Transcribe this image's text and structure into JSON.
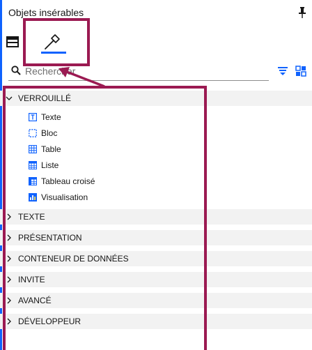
{
  "panel": {
    "title": "Objets insérables",
    "pin_icon": "pin-icon"
  },
  "tabs": [
    {
      "icon": "layout-icon",
      "selected": false
    },
    {
      "icon": "hammer-icon",
      "selected": true
    }
  ],
  "search": {
    "placeholder": "Rechercher",
    "icons": [
      "search-icon",
      "filter-icon",
      "grid-view-icon"
    ]
  },
  "tree": {
    "groups": [
      {
        "label": "VERROUILLÉ",
        "expanded": true,
        "items": [
          {
            "label": "Texte",
            "icon": "text-icon"
          },
          {
            "label": "Bloc",
            "icon": "block-icon"
          },
          {
            "label": "Table",
            "icon": "table-icon"
          },
          {
            "label": "Liste",
            "icon": "list-icon"
          },
          {
            "label": "Tableau croisé",
            "icon": "crosstab-icon"
          },
          {
            "label": "Visualisation",
            "icon": "visualization-icon"
          }
        ]
      },
      {
        "label": "TEXTE",
        "expanded": false
      },
      {
        "label": "PRÉSENTATION",
        "expanded": false
      },
      {
        "label": "CONTENEUR DE DONNÉES",
        "expanded": false
      },
      {
        "label": "INVITE",
        "expanded": false
      },
      {
        "label": "AVANCÉ",
        "expanded": false
      },
      {
        "label": "DÉVELOPPEUR",
        "expanded": false
      }
    ]
  },
  "colors": {
    "accent": "#0f62fe",
    "highlight": "#9b1a52",
    "group_background": "#f2f2f2"
  }
}
